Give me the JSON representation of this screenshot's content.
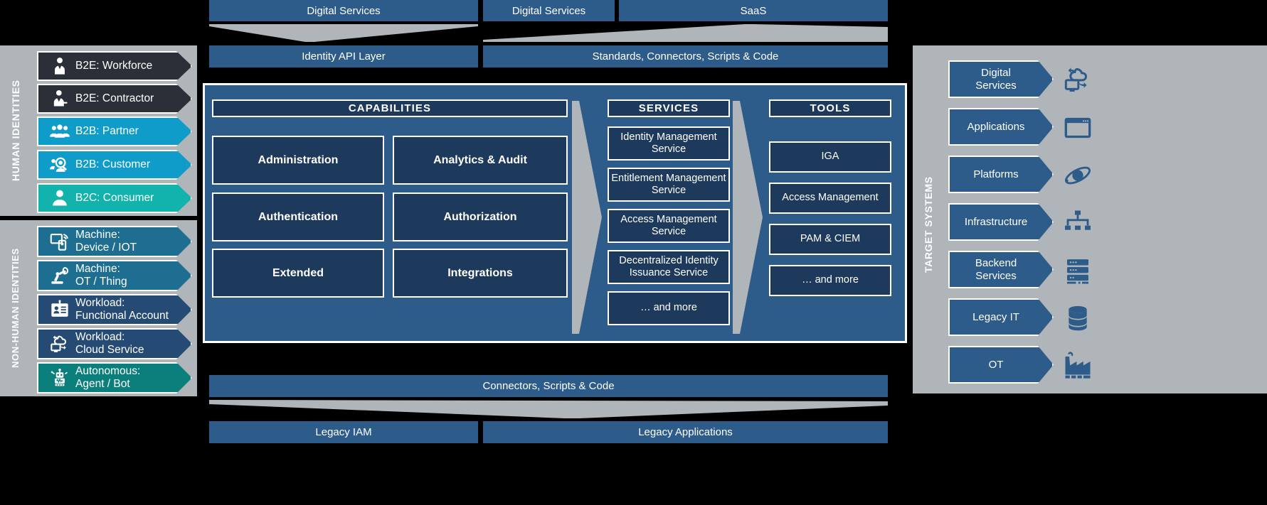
{
  "colors": {
    "background": "#000000",
    "panel_grey": "#b0b5b9",
    "bar_blue": "#2e5c8a",
    "box_navy": "#1d3a5c",
    "dark": "#2b3038",
    "cyan": "#0f9cc8",
    "teal": "#12b3ac",
    "teal_dark": "#0b7f7c",
    "steel": "#1d6e91",
    "white": "#ffffff"
  },
  "top_bars": [
    {
      "label": "Digital Services"
    },
    {
      "label": "Digital Services"
    },
    {
      "label": "SaaS"
    }
  ],
  "api_bars": [
    {
      "label": "Identity API Layer"
    },
    {
      "label": "Standards, Connectors, Scripts & Code"
    }
  ],
  "bottom_bars": {
    "connectors": {
      "label": "Connectors, Scripts & Code"
    },
    "legacy": [
      {
        "label": "Legacy IAM"
      },
      {
        "label": "Legacy Applications"
      }
    ]
  },
  "human_identities": {
    "title": "HUMAN IDENTITIES",
    "items": [
      {
        "label": "B2E: Workforce",
        "icon": "user-tie-icon",
        "color": "#2b3038"
      },
      {
        "label": "B2E: Contractor",
        "icon": "user-badge-icon",
        "color": "#2b3038"
      },
      {
        "label": "B2B: Partner",
        "icon": "users-group-icon",
        "color": "#0f9cc8"
      },
      {
        "label": "B2B: Customer",
        "icon": "user-search-icon",
        "color": "#0f9cc8"
      },
      {
        "label": "B2C: Consumer",
        "icon": "user-solid-icon",
        "color": "#12b3ac"
      }
    ]
  },
  "non_human_identities": {
    "title": "NON-HUMAN IDENTITIES",
    "items": [
      {
        "label": "Machine:\nDevice / IOT",
        "icon": "device-wireless-icon",
        "color": "#1d6e91"
      },
      {
        "label": "Machine:\nOT / Thing",
        "icon": "robot-arm-icon",
        "color": "#1d6e91"
      },
      {
        "label": "Workload:\nFunctional Account",
        "icon": "id-card-icon",
        "color": "#254a74"
      },
      {
        "label": "Workload:\nCloud Service",
        "icon": "cloud-desktop-icon",
        "color": "#254a74"
      },
      {
        "label": "Autonomous:\nAgent / Bot",
        "icon": "robot-icon",
        "color": "#0b7f7c"
      }
    ]
  },
  "main": {
    "capabilities": {
      "heading": "CAPABILITIES",
      "items": [
        "Administration",
        "Analytics & Audit",
        "Authentication",
        "Authorization",
        "Extended",
        "Integrations"
      ]
    },
    "services": {
      "heading": "SERVICES",
      "items": [
        "Identity Management\nService",
        "Entitlement  Management\nService",
        "Access Management\nService",
        "Decentralized Identity\nIssuance Service",
        "… and more"
      ]
    },
    "tools": {
      "heading": "TOOLS",
      "items": [
        "IGA",
        "Access Management",
        "PAM & CIEM",
        "… and more"
      ]
    }
  },
  "target_systems": {
    "title": "TARGET SYSTEMS",
    "items": [
      {
        "label": "Digital\nServices",
        "icon": "cloud-desktop-icon"
      },
      {
        "label": "Applications",
        "icon": "window-app-icon"
      },
      {
        "label": "Platforms",
        "icon": "orbit-icon"
      },
      {
        "label": "Infrastructure",
        "icon": "network-tree-icon"
      },
      {
        "label": "Backend\nServices",
        "icon": "server-rack-icon"
      },
      {
        "label": "Legacy IT",
        "icon": "database-icon"
      },
      {
        "label": "OT",
        "icon": "factory-icon"
      }
    ]
  }
}
